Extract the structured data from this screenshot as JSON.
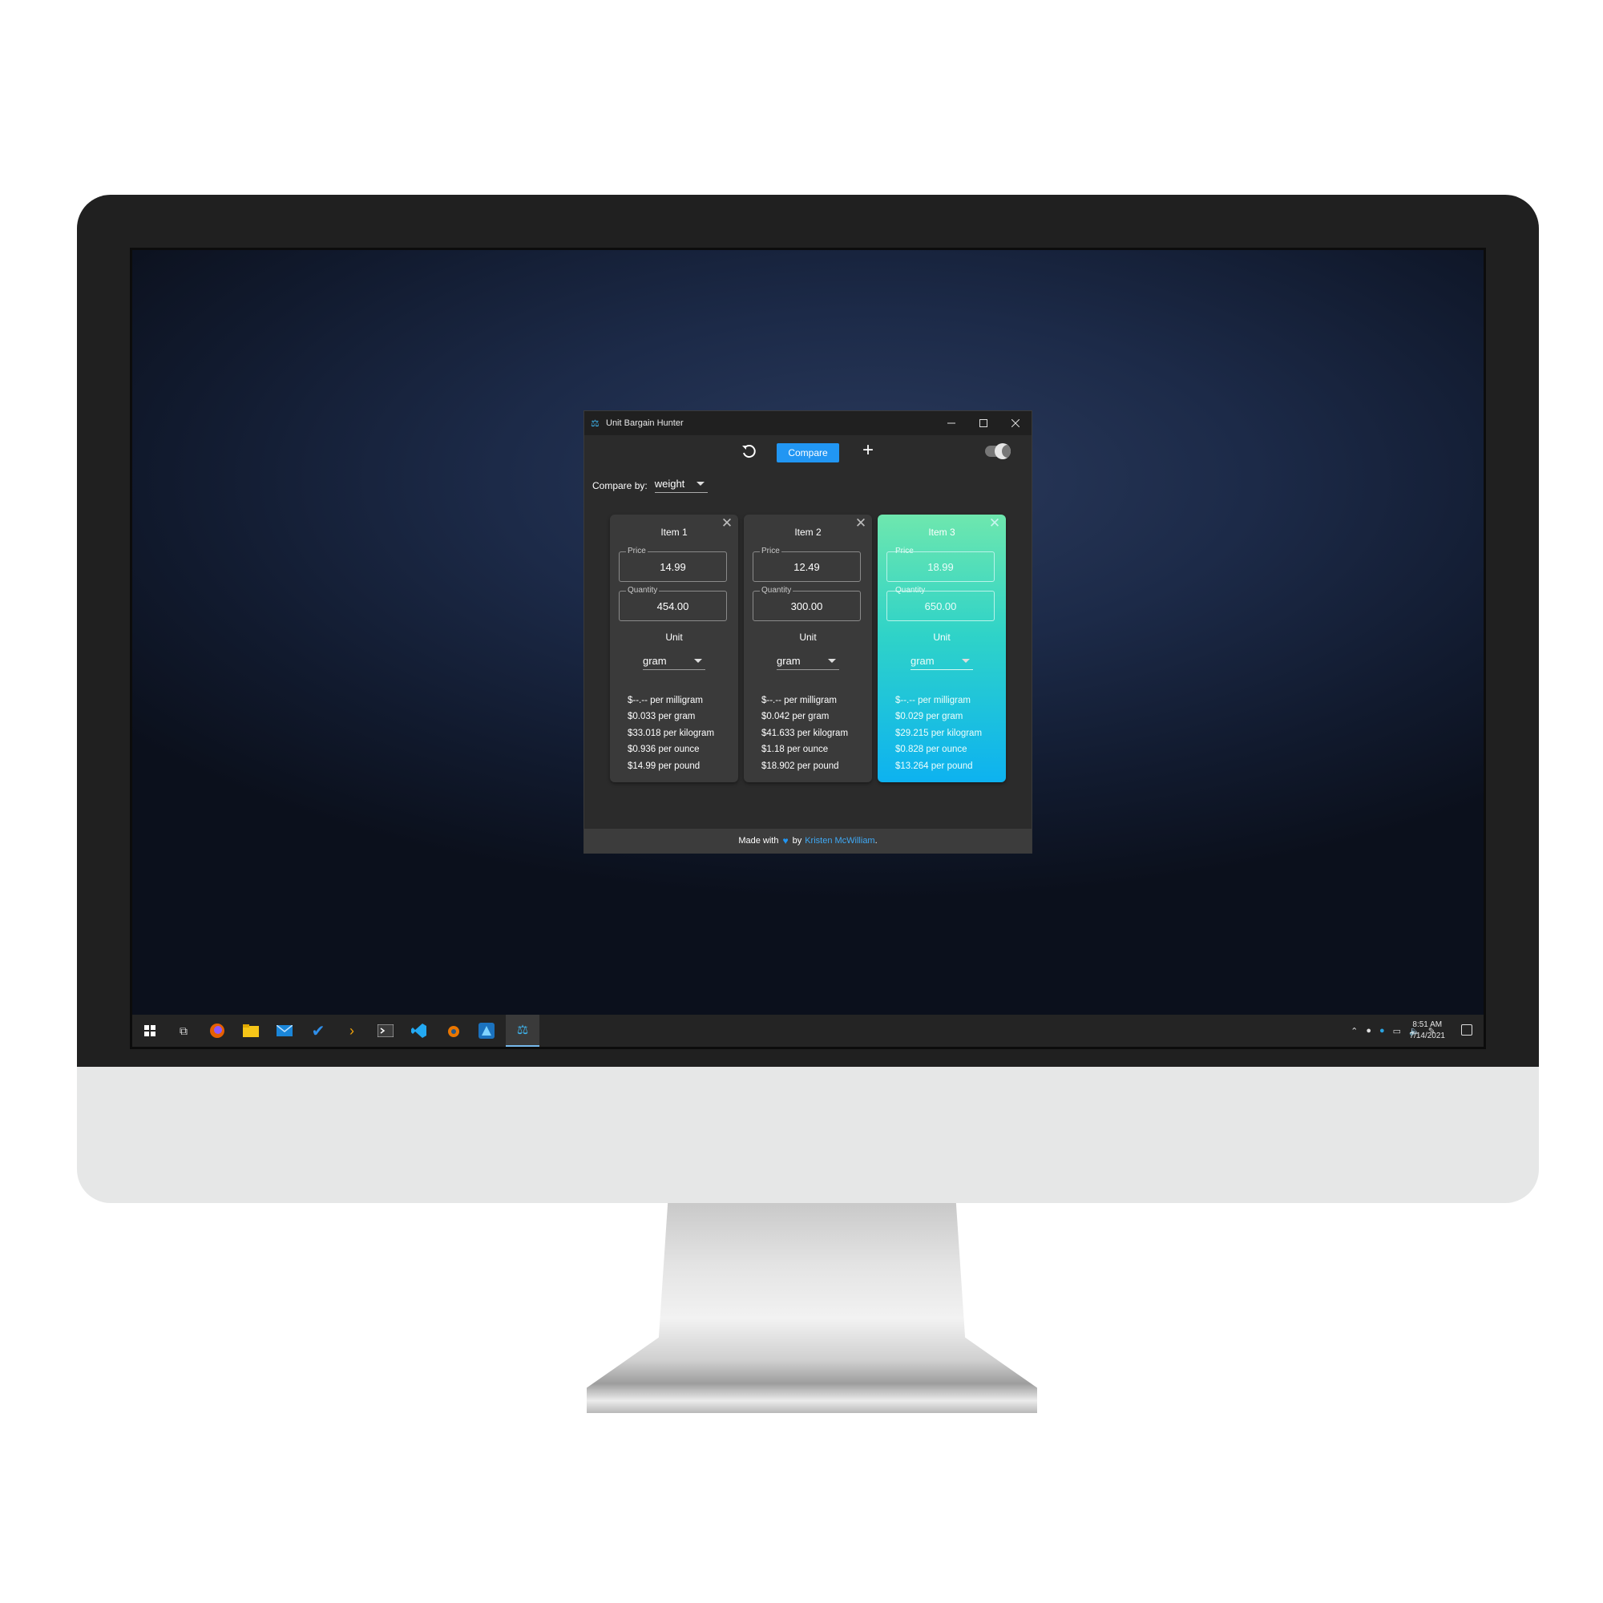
{
  "window": {
    "title": "Unit Bargain Hunter"
  },
  "toolbar": {
    "compare_label": "Compare",
    "add_label": "+"
  },
  "compare_by": {
    "label": "Compare by:",
    "value": "weight"
  },
  "unit_label": "Unit",
  "field_labels": {
    "price": "Price",
    "quantity": "Quantity"
  },
  "items": [
    {
      "title": "Item 1",
      "price": "14.99",
      "quantity": "454.00",
      "unit": "gram",
      "results": [
        "$--.-- per milligram",
        "$0.033 per gram",
        "$33.018 per kilogram",
        "$0.936 per ounce",
        "$14.99 per pound"
      ]
    },
    {
      "title": "Item 2",
      "price": "12.49",
      "quantity": "300.00",
      "unit": "gram",
      "results": [
        "$--.-- per milligram",
        "$0.042 per gram",
        "$41.633 per kilogram",
        "$1.18 per ounce",
        "$18.902 per pound"
      ]
    },
    {
      "title": "Item 3",
      "price": "18.99",
      "quantity": "650.00",
      "unit": "gram",
      "best": true,
      "results": [
        "$--.-- per milligram",
        "$0.029 per gram",
        "$29.215 per kilogram",
        "$0.828 per ounce",
        "$13.264 per pound"
      ]
    }
  ],
  "footer": {
    "made_with": "Made with",
    "by": "by",
    "author": "Kristen McWilliam",
    "period": "."
  },
  "taskbar": {
    "time": "8:51 AM",
    "date": "7/14/2021",
    "pinned_icons": [
      "windows-start-icon",
      "task-view-icon",
      "firefox-icon",
      "file-explorer-icon",
      "mail-icon",
      "todo-icon",
      "prompt-icon",
      "terminal-icon",
      "vscode-icon",
      "blender-icon",
      "affinity-icon",
      "unit-bargain-hunter-icon"
    ]
  },
  "colors": {
    "accent": "#2196f3",
    "best_gradient_top": "#6ee7ae",
    "best_gradient_bottom": "#0db2f0",
    "window_bg": "#2b2b2b"
  }
}
